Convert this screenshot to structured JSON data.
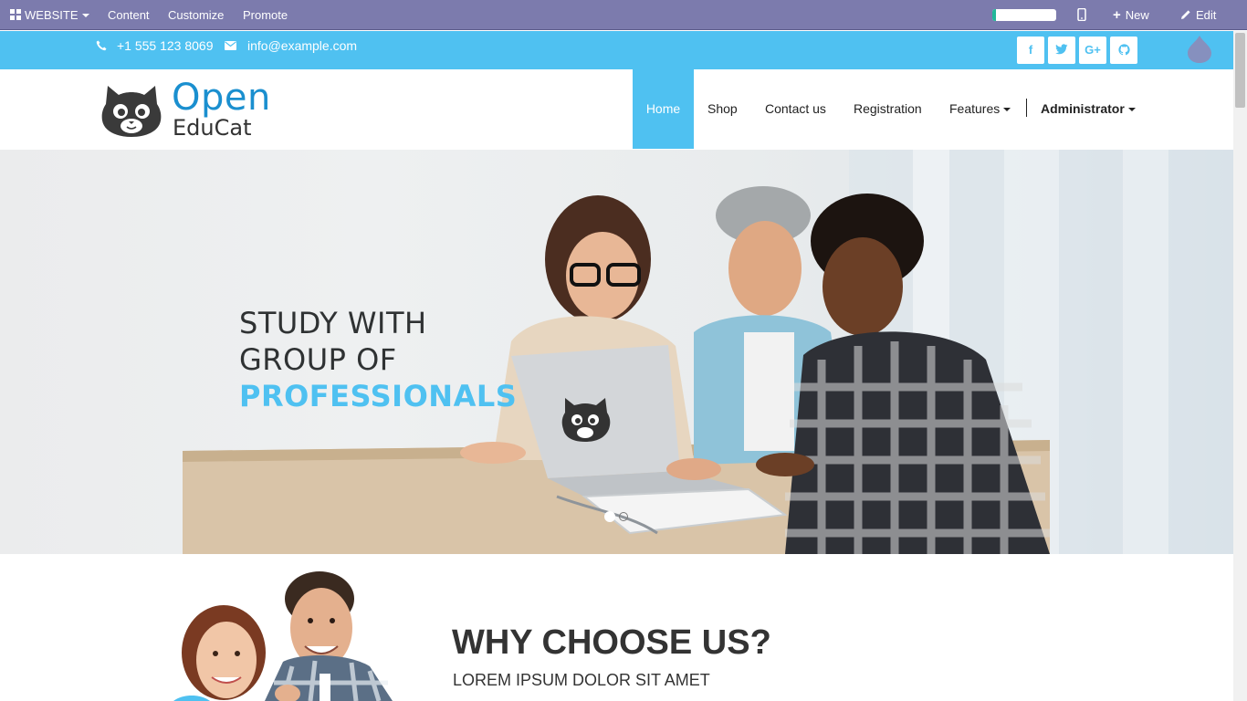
{
  "admin_bar": {
    "website_label": "WEBSITE",
    "content_label": "Content",
    "customize_label": "Customize",
    "promote_label": "Promote",
    "progress_fraction": 0.05,
    "new_label": "New",
    "edit_label": "Edit"
  },
  "topbar": {
    "phone": "+1 555 123 8069",
    "email": "info@example.com",
    "social": [
      {
        "icon": "facebook-icon",
        "glyph": "f"
      },
      {
        "icon": "twitter-icon",
        "glyph": "t"
      },
      {
        "icon": "google-plus-icon",
        "glyph": "G+"
      },
      {
        "icon": "github-icon",
        "glyph": "⌥"
      }
    ]
  },
  "header": {
    "logo_line1": "Open",
    "logo_line2": "EduCat",
    "nav": {
      "home": "Home",
      "shop": "Shop",
      "contact": "Contact us",
      "registration": "Registration",
      "features": "Features",
      "admin": "Administrator"
    }
  },
  "hero": {
    "line1": "STUDY WITH",
    "line2": "GROUP OF",
    "line3": "PROFESSIONALS",
    "slide_count": 2,
    "active_slide": 1
  },
  "why": {
    "title": "WHY CHOOSE US?",
    "subtitle": "LOREM IPSUM DOLOR SIT AMET"
  },
  "colors": {
    "admin_bar": "#7c7bad",
    "accent": "#4fc1f1",
    "logo_blue": "#1a8fcf"
  }
}
